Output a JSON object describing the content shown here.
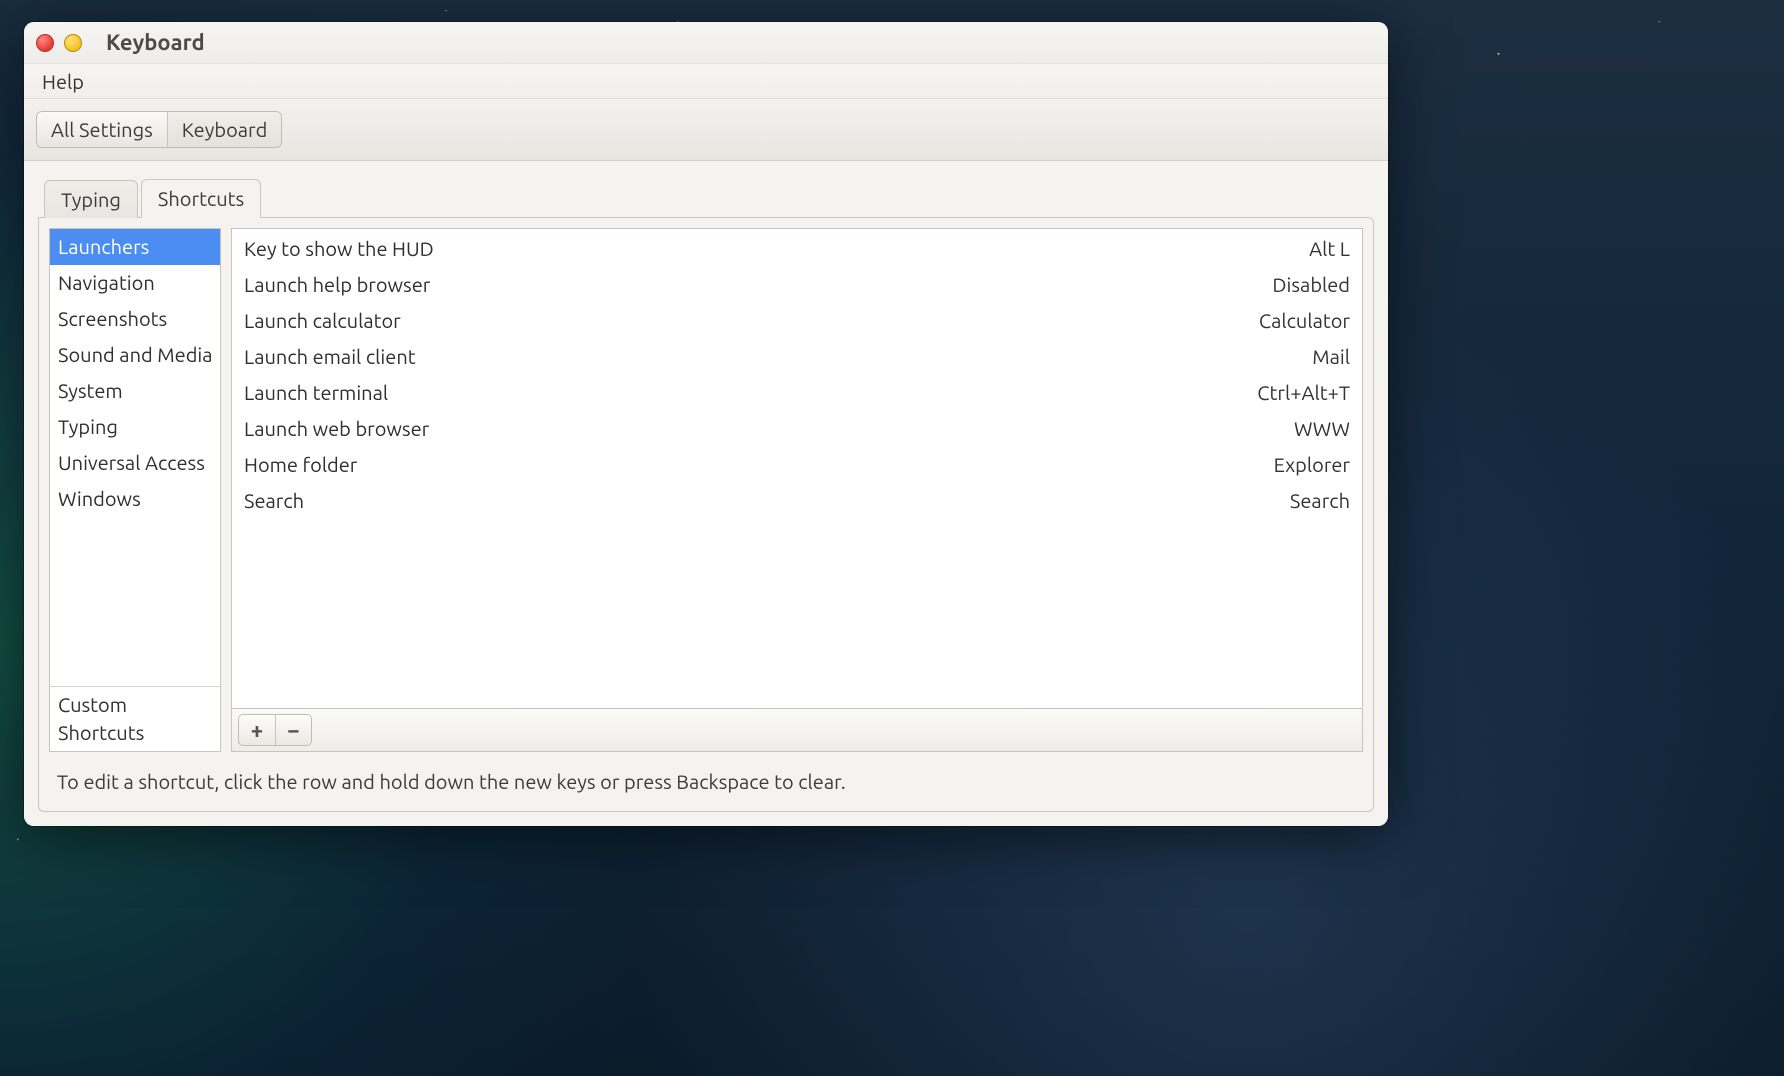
{
  "window": {
    "title": "Keyboard"
  },
  "menubar": {
    "help": "Help"
  },
  "breadcrumb": {
    "all_settings": "All Settings",
    "keyboard": "Keyboard"
  },
  "tabs": {
    "typing": "Typing",
    "shortcuts": "Shortcuts",
    "active": "shortcuts"
  },
  "categories": {
    "items": [
      "Launchers",
      "Navigation",
      "Screenshots",
      "Sound and Media",
      "System",
      "Typing",
      "Universal Access",
      "Windows"
    ],
    "custom": "Custom Shortcuts",
    "selected_index": 0
  },
  "shortcuts": [
    {
      "label": "Key to show the HUD",
      "key": "Alt L"
    },
    {
      "label": "Launch help browser",
      "key": "Disabled"
    },
    {
      "label": "Launch calculator",
      "key": "Calculator"
    },
    {
      "label": "Launch email client",
      "key": "Mail"
    },
    {
      "label": "Launch terminal",
      "key": "Ctrl+Alt+T"
    },
    {
      "label": "Launch web browser",
      "key": "WWW"
    },
    {
      "label": "Home folder",
      "key": "Explorer"
    },
    {
      "label": "Search",
      "key": "Search"
    }
  ],
  "buttons": {
    "add": "+",
    "remove": "−"
  },
  "hint": "To edit a shortcut, click the row and hold down the new keys or press Backspace to clear."
}
